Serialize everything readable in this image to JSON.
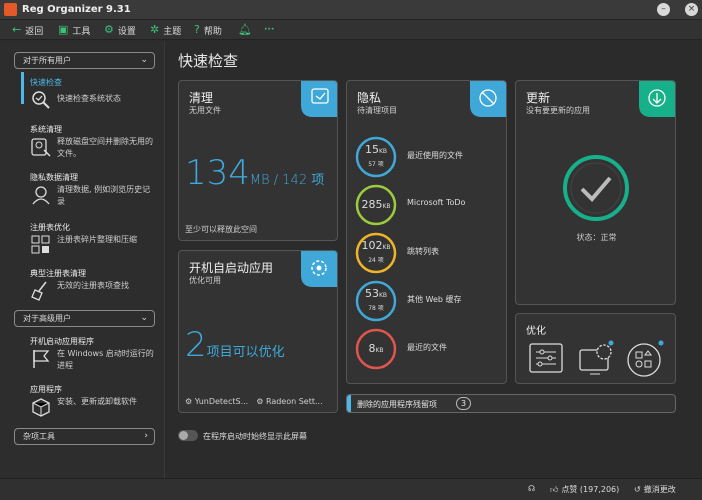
{
  "window": {
    "title": "Reg Organizer 9.31"
  },
  "toolbar": {
    "back": "返回",
    "tools": "工具",
    "settings": "设置",
    "theme": "主题",
    "help": "帮助",
    "more": "···"
  },
  "sidebar": {
    "section_all_users": "对于所有用户",
    "items": [
      {
        "title": "快速检查",
        "desc": "快速检查系统状态"
      },
      {
        "title": "系统清理",
        "desc": "释放磁盘空间并删除无用的文件。"
      },
      {
        "title": "隐私数据清理",
        "desc": "清理数据, 例如浏览历史记录"
      },
      {
        "title": "注册表优化",
        "desc": "注册表碎片整理和压缩"
      },
      {
        "title": "典型注册表清理",
        "desc": "无效的注册表项查找"
      }
    ],
    "section_advanced": "对于高级用户",
    "adv_items": [
      {
        "title": "开机启动应用程序",
        "desc": "在 Windows 启动时运行的进程"
      },
      {
        "title": "应用程序",
        "desc": "安装、更新或卸载软件"
      }
    ],
    "section_misc": "杂项工具",
    "toggle_label": "在程序启动时始终显示此屏幕"
  },
  "main": {
    "title": "快速检查",
    "clean": {
      "title": "清理",
      "sub": "无用文件",
      "value": "134",
      "unit": "MB / 142 项",
      "foot": "至少可以释放此空间"
    },
    "startup": {
      "title": "开机自启动应用",
      "sub": "优化可用",
      "value": "2",
      "unit": "项目可以优化",
      "apps": [
        "YunDetectS...",
        "Radeon Sett..."
      ]
    },
    "privacy": {
      "title": "隐私",
      "sub": "待清理项目",
      "rows": [
        {
          "size": "15",
          "unit": "KB",
          "count": "57 项",
          "label": "最近使用的文件",
          "color": "#3fa8d9"
        },
        {
          "size": "285",
          "unit": "KB",
          "count": "",
          "label": "Microsoft ToDo",
          "color": "#9ccc3c"
        },
        {
          "size": "102",
          "unit": "KB",
          "count": "24 项",
          "label": "跳转列表",
          "color": "#f0b429"
        },
        {
          "size": "53",
          "unit": "KB",
          "count": "78 项",
          "label": "其他 Web 缓存",
          "color": "#3fa8d9"
        },
        {
          "size": "8",
          "unit": "KB",
          "count": "",
          "label": "最近的文件",
          "color": "#e0564c"
        }
      ]
    },
    "update": {
      "title": "更新",
      "sub": "没有要更新的应用",
      "status": "状态：正常"
    },
    "optimize": {
      "title": "优化"
    },
    "leftovers": {
      "label": "删除的应用程序残留项",
      "count": "3"
    }
  },
  "status": {
    "likes": "点赞 (197,206)",
    "undo": "撤消更改"
  },
  "colors": {
    "accent_blue": "#3fa8d9",
    "accent_green": "#16b08a"
  }
}
